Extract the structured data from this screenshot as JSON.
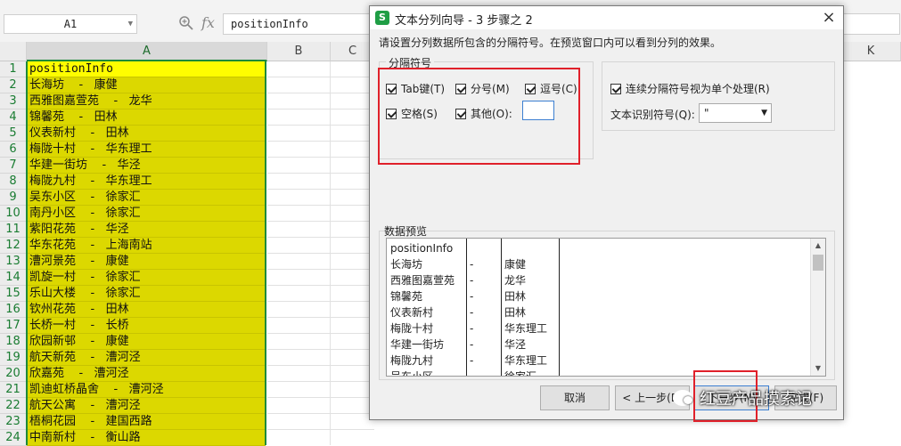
{
  "formula_bar": {
    "cell_ref": "A1",
    "fx_label": "fx",
    "content": "positionInfo"
  },
  "columns": [
    "A",
    "B",
    "C",
    "K"
  ],
  "rows": [
    {
      "n": "1",
      "text": "positionInfo"
    },
    {
      "n": "2",
      "text": "长海坊    -   康健"
    },
    {
      "n": "3",
      "text": "西雅图嘉萱苑    -   龙华"
    },
    {
      "n": "4",
      "text": "锦馨苑    -   田林"
    },
    {
      "n": "5",
      "text": "仪表新村    -   田林"
    },
    {
      "n": "6",
      "text": "梅陇十村    -   华东理工"
    },
    {
      "n": "7",
      "text": "华建一街坊    -   华泾"
    },
    {
      "n": "8",
      "text": "梅陇九村    -   华东理工"
    },
    {
      "n": "9",
      "text": "吴东小区    -   徐家汇"
    },
    {
      "n": "10",
      "text": "南丹小区    -   徐家汇"
    },
    {
      "n": "11",
      "text": "紫阳花苑    -   华泾"
    },
    {
      "n": "12",
      "text": "华东花苑    -   上海南站"
    },
    {
      "n": "13",
      "text": "漕河景苑    -   康健"
    },
    {
      "n": "14",
      "text": "凯旋一村    -   徐家汇"
    },
    {
      "n": "15",
      "text": "乐山大楼    -   徐家汇"
    },
    {
      "n": "16",
      "text": "钦州花苑    -   田林"
    },
    {
      "n": "17",
      "text": "长桥一村    -   长桥"
    },
    {
      "n": "18",
      "text": "欣园新邨    -   康健"
    },
    {
      "n": "19",
      "text": "航天新苑    -   漕河泾"
    },
    {
      "n": "20",
      "text": "欣嘉苑    -   漕河泾"
    },
    {
      "n": "21",
      "text": "凯迪虹桥晶舍    -   漕河泾"
    },
    {
      "n": "22",
      "text": "航天公寓    -   漕河泾"
    },
    {
      "n": "23",
      "text": "梧桐花园    -   建国西路"
    },
    {
      "n": "24",
      "text": "中南新村    -   衡山路"
    }
  ],
  "dialog": {
    "title": "文本分列向导 - 3 步骤之 2",
    "title_icon": "S",
    "instruction": "请设置分列数据所包含的分隔符号。在预览窗口内可以看到分列的效果。",
    "delimiters_group": "分隔符号",
    "delimiters": {
      "tab": "Tab键(T)",
      "semicolon": "分号(M)",
      "comma": "逗号(C)",
      "space": "空格(S)",
      "other": "其他(O):"
    },
    "consecutive": "连续分隔符号视为单个处理(R)",
    "qualifier_label": "文本识别符号(Q):",
    "qualifier_value": "\"",
    "preview_label": "数据预览",
    "preview_rows": [
      [
        "positionInfo",
        "",
        ""
      ],
      [
        "长海坊",
        "-",
        "康健"
      ],
      [
        "西雅图嘉萱苑",
        "-",
        "龙华"
      ],
      [
        "锦馨苑",
        "-",
        "田林"
      ],
      [
        "仪表新村",
        "-",
        "田林"
      ],
      [
        "梅陇十村",
        "-",
        "华东理工"
      ],
      [
        "华建一街坊",
        "-",
        "华泾"
      ],
      [
        "梅陇九村",
        "-",
        "华东理工"
      ],
      [
        "吴东小区",
        "-",
        "徐家汇"
      ]
    ],
    "buttons": {
      "cancel": "取消",
      "back": "< 上一步(B)",
      "next": "下一步(N)",
      "finish": "完成(F)"
    }
  },
  "watermark": "红豆产品摸索记"
}
